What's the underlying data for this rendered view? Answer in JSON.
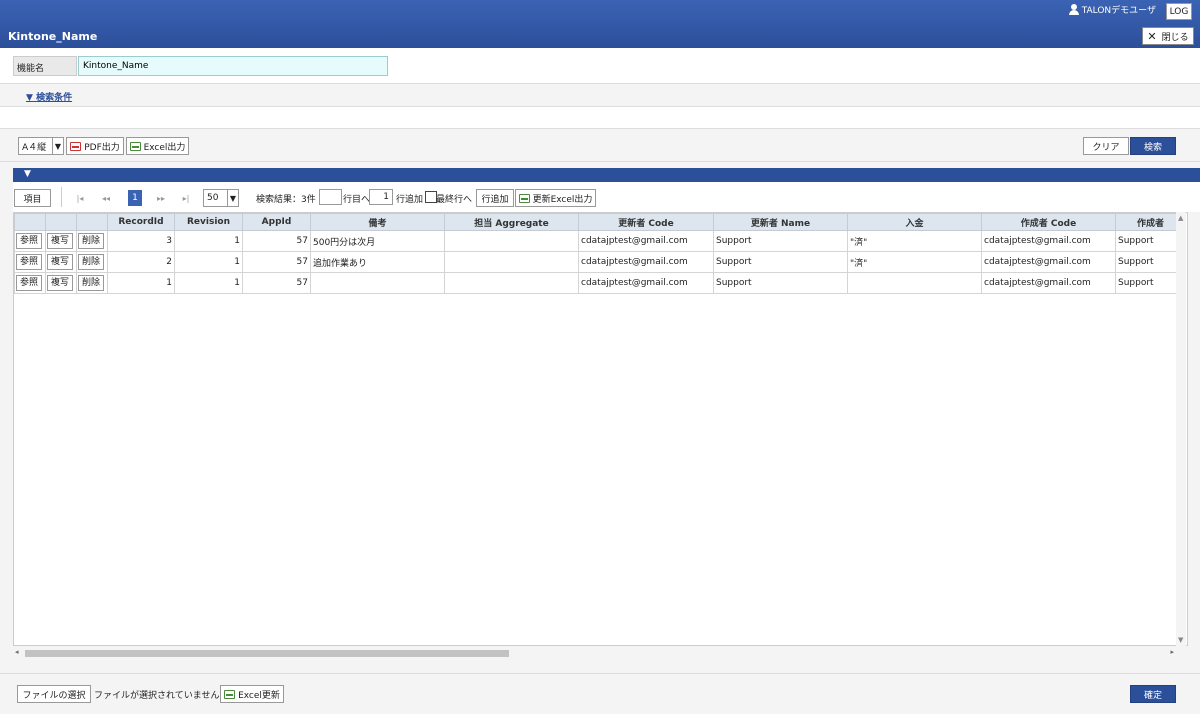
{
  "header": {
    "app_title": "Kintone_Name",
    "user_name": "TALONデモユーザ",
    "log_label": "LOG",
    "close_label": "閉じる"
  },
  "form": {
    "field_label": "機能名",
    "field_value": "Kintone_Name",
    "search_conditions_label": "検索条件"
  },
  "toolbar": {
    "paper_size": "A４縦",
    "pdf_label": "PDF出力",
    "excel_label": "Excel出力",
    "clear_label": "クリア",
    "search_label": "検索"
  },
  "grid_toolbar": {
    "columns_label": "項目",
    "current_page": "1",
    "page_size": "50",
    "result_text": "検索結果：3件",
    "goto_value": "",
    "goto_row_label": "行目へ",
    "add_count": "1",
    "add_row_label": "行追加",
    "last_row_label": "最終行へ",
    "add_button_label": "行追加",
    "excel_update_label": "更新Excel出力"
  },
  "table": {
    "columns": [
      "",
      "",
      "",
      "RecordId",
      "Revision",
      "AppId",
      "備考",
      "担当 Aggregate",
      "更新者 Code",
      "更新者 Name",
      "入金",
      "作成者 Code",
      "作成者"
    ],
    "action_labels": {
      "view": "参照",
      "copy": "複写",
      "delete": "削除"
    },
    "rows": [
      {
        "record_id": "3",
        "revision": "1",
        "app_id": "57",
        "note": "500円分は次月",
        "aggregate": "",
        "updater_code": "cdatajptest@gmail.com",
        "updater_name": "Support",
        "payment": "\"済\"",
        "creator_code": "cdatajptest@gmail.com",
        "creator": "Support"
      },
      {
        "record_id": "2",
        "revision": "1",
        "app_id": "57",
        "note": "追加作業あり",
        "aggregate": "",
        "updater_code": "cdatajptest@gmail.com",
        "updater_name": "Support",
        "payment": "\"済\"",
        "creator_code": "cdatajptest@gmail.com",
        "creator": "Support"
      },
      {
        "record_id": "1",
        "revision": "1",
        "app_id": "57",
        "note": "",
        "aggregate": "",
        "updater_code": "cdatajptest@gmail.com",
        "updater_name": "Support",
        "payment": "",
        "creator_code": "cdatajptest@gmail.com",
        "creator": "Support"
      }
    ]
  },
  "footer": {
    "file_select_label": "ファイルの選択",
    "file_status": "ファイルが選択されていません",
    "excel_update_label": "Excel更新",
    "confirm_label": "確定"
  },
  "colors": {
    "header_blue": "#2c4f9a",
    "accent_blue": "#3b63b4"
  },
  "icons": [
    "user-icon",
    "close-icon",
    "printer-icon",
    "chevron-down-icon",
    "first-page-icon",
    "prev-page-icon",
    "next-page-icon",
    "last-page-icon"
  ]
}
